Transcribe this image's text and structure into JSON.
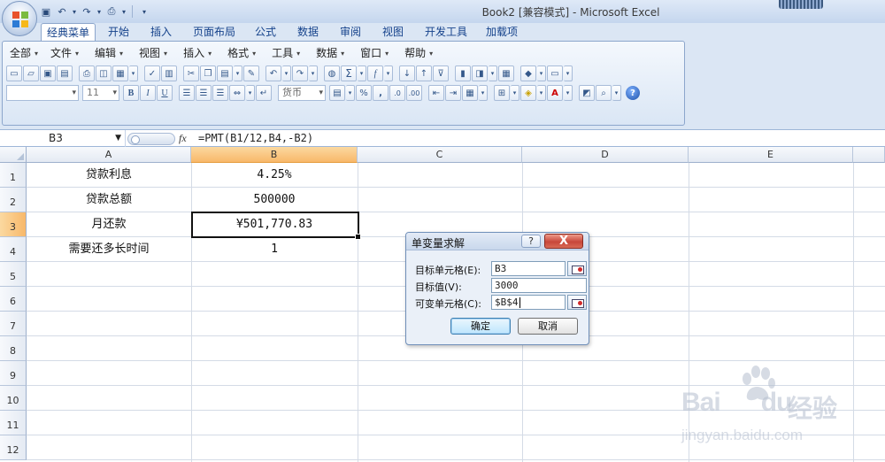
{
  "window": {
    "title": "Book2  [兼容模式] - Microsoft Excel"
  },
  "tabs": [
    {
      "label": "经典菜单",
      "active": true
    },
    {
      "label": "开始"
    },
    {
      "label": "插入"
    },
    {
      "label": "页面布局"
    },
    {
      "label": "公式"
    },
    {
      "label": "数据"
    },
    {
      "label": "审阅"
    },
    {
      "label": "视图"
    },
    {
      "label": "开发工具"
    },
    {
      "label": "加载项"
    }
  ],
  "menus": [
    "全部",
    "文件",
    "编辑",
    "视图",
    "插入",
    "格式",
    "工具",
    "数据",
    "窗口",
    "帮助"
  ],
  "toolbar": {
    "font_size": "11",
    "number_format": "货币",
    "bold": "B",
    "italic": "I",
    "underline": "U",
    "sum": "Σ",
    "percent": "%",
    "comma": ","
  },
  "formula_bar": {
    "name_box": "B3",
    "fx": "fx",
    "formula": "=PMT(B1/12,B4,-B2)"
  },
  "columns": [
    "A",
    "B",
    "C",
    "D",
    "E"
  ],
  "rows": [
    "1",
    "2",
    "3",
    "4",
    "5",
    "6",
    "7",
    "8",
    "9",
    "10",
    "11",
    "12"
  ],
  "cells": {
    "A1": "贷款利息",
    "A2": "贷款总额",
    "A3": "月还款",
    "A4": "需要还多长时间",
    "B1": "4.25%",
    "B2": "500000",
    "B3": "¥501,770.83",
    "B4": "1"
  },
  "active_cell": "B3",
  "dialog": {
    "title": "单变量求解",
    "help": "?",
    "close": "X",
    "fields": [
      {
        "label": "目标单元格(E):",
        "value": "B3"
      },
      {
        "label": "目标值(V):",
        "value": "3000"
      },
      {
        "label": "可变单元格(C):",
        "value": "$B$4"
      }
    ],
    "ok": "确定",
    "cancel": "取消"
  },
  "watermark": {
    "brand_left": "Bai",
    "brand_right": "du",
    "product": "经验",
    "url": "jingyan.baidu.com"
  },
  "colors": {
    "selection_header": "#f8b86a",
    "ribbon_tab_text": "#15428b",
    "close_button": "#c8463a"
  }
}
